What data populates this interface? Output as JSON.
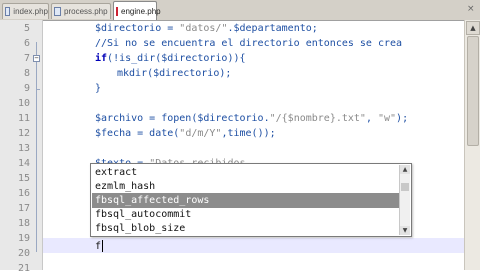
{
  "tabs": [
    {
      "label": "index.php",
      "active": false
    },
    {
      "label": "process.php",
      "active": false
    },
    {
      "label": "engine.php",
      "active": true
    }
  ],
  "tab_close_glyph": "×",
  "line_numbers": [
    "5",
    "6",
    "7",
    "8",
    "9",
    "10",
    "11",
    "12",
    "13",
    "14",
    "15",
    "16",
    "17",
    "18",
    "19",
    "20",
    "21"
  ],
  "code": {
    "l5": {
      "a": "$directorio = ",
      "b": "\"datos/\"",
      "c": ".$departamento;"
    },
    "l6": {
      "text": "//Si no se encuentra el directorio entonces se crea"
    },
    "l7": {
      "kw": "if",
      "rest": "(!is_dir($directorio)){"
    },
    "l8": {
      "text": "mkdir($directorio);"
    },
    "l9": {
      "text": "}"
    },
    "l11": {
      "a": "$archivo = fopen($directorio.",
      "b": "\"/{$nombre}.txt\"",
      "c": ", ",
      "d": "\"w\"",
      "e": ");"
    },
    "l12": {
      "a": "$fecha = date(",
      "b": "\"d/m/Y\"",
      "c": ",time());"
    },
    "l14": {
      "a": "$texto = ",
      "b": "\"Datos recibidos"
    },
    "l20": {
      "text": "f"
    }
  },
  "autocomplete": {
    "items": [
      "extract",
      "ezmlm_hash",
      "fbsql_affected_rows",
      "fbsql_autocommit",
      "fbsql_blob_size"
    ],
    "selected_index": 2
  },
  "colors": {
    "code": "#1e4fa3",
    "string": "#8a8a8a",
    "comment": "#3b7dd8",
    "keyword": "#0000b8",
    "selection": "#8c8c8c",
    "current_line": "#e9e9ff"
  },
  "icons": {
    "fold_open": "minus-box",
    "fold_close": "corner-tick",
    "scroll_up": "triangle-up",
    "scroll_down": "triangle-down"
  }
}
